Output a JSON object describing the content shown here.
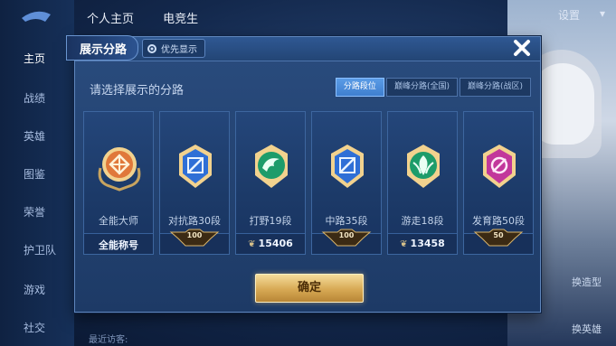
{
  "background": {
    "top_tabs": [
      "个人主页",
      "电竞生"
    ],
    "settings_label": "设置",
    "nav_items": [
      "主页",
      "战绩",
      "英雄",
      "图鉴",
      "荣誉",
      "护卫队",
      "游戏",
      "社交"
    ],
    "right_buttons": [
      "换造型",
      "换英雄"
    ],
    "bottom_text": "最近访客:"
  },
  "dialog": {
    "title": "展示分路",
    "priority_label": "优先显示",
    "subtitle": "请选择展示的分路",
    "tabs": [
      {
        "label": "分路段位",
        "active": true
      },
      {
        "label": "巅峰分路(全国)",
        "active": false
      },
      {
        "label": "巅峰分路(战区)",
        "active": false
      }
    ],
    "cards": [
      {
        "label": "全能大师",
        "footer_type": "text",
        "footer_text": "全能称号",
        "emblem": "all-round-emblem-icon",
        "color": "#e0783a"
      },
      {
        "label": "对抗路30段",
        "footer_type": "badge",
        "badge": "100",
        "emblem": "clash-lane-emblem-icon",
        "color": "#2f6fd6"
      },
      {
        "label": "打野19段",
        "footer_type": "score",
        "score": "15406",
        "emblem": "jungle-emblem-icon",
        "color": "#1d9c6a"
      },
      {
        "label": "中路35段",
        "footer_type": "badge",
        "badge": "100",
        "emblem": "mid-lane-emblem-icon",
        "color": "#2f6fd6"
      },
      {
        "label": "游走18段",
        "footer_type": "score",
        "score": "13458",
        "emblem": "roam-emblem-icon",
        "color": "#1d9c6a"
      },
      {
        "label": "发育路50段",
        "footer_type": "badge",
        "badge": "50",
        "emblem": "farm-lane-emblem-icon",
        "color": "#c2379b"
      }
    ],
    "confirm_label": "确定"
  }
}
